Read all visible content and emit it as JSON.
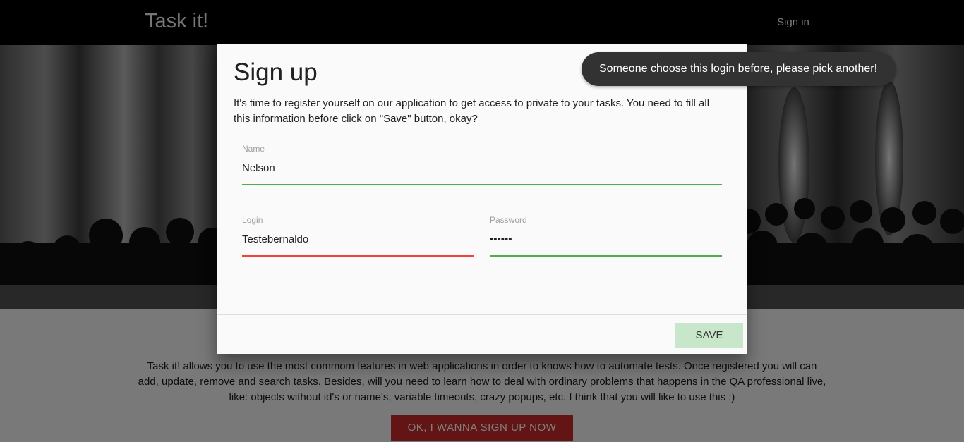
{
  "navbar": {
    "brand": "Task it!",
    "sign_in": "Sign in"
  },
  "info": {
    "description": "Task it! allows you to use the most commom features in web applications in order to knows how to automate tests. Once registered you will can add, update, remove and search tasks. Besides, will you need to learn how to deal with ordinary problems that happens in the QA professional live, like: objects without id's or name's, variable timeouts, crazy popups, etc. I think that you will like to use this :)",
    "cta_label": "OK, I WANNA SIGN UP NOW"
  },
  "modal": {
    "title": "Sign up",
    "description": "It's time to register yourself on our application to get access to private to your tasks. You need to fill all this information before click on \"Save\" button, okay?",
    "fields": {
      "name": {
        "label": "Name",
        "value": "Nelson",
        "state": "valid"
      },
      "login": {
        "label": "Login",
        "value": "Testebernaldo",
        "state": "invalid"
      },
      "password": {
        "label": "Password",
        "value": "••••••",
        "state": "valid"
      }
    },
    "save_label": "SAVE"
  },
  "toast": {
    "message": "Someone choose this login before, please pick another!"
  },
  "colors": {
    "valid_underline": "#4caf50",
    "invalid_underline": "#f44336",
    "cta_background": "#c62828",
    "save_background": "#c8e6c9",
    "toast_background": "#323232"
  }
}
